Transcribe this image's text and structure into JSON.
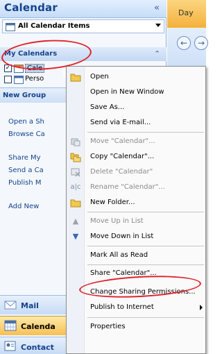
{
  "pane": {
    "title": "Calendar",
    "collapse_glyph": "«",
    "view_select_label": "All Calendar Items",
    "my_calendars_label": "My Calendars",
    "my_calendars_chevron": "⌃",
    "calendars": [
      {
        "label": "Cale",
        "checked": true
      },
      {
        "label": "Perso",
        "checked": false
      }
    ],
    "new_group_label": "New Group",
    "links": {
      "open": "Open a Sh",
      "browse": "Browse Ca",
      "share": "Share My",
      "send": "Send a Ca",
      "publish": "Publish M",
      "add_new": "Add New"
    },
    "nav_buttons": {
      "mail": "Mail",
      "calendar": "Calenda",
      "contacts": "Contact"
    }
  },
  "calendar_area": {
    "tab_day": "Day",
    "prev_glyph": "←",
    "next_glyph": "→"
  },
  "context_menu": {
    "items": [
      {
        "label": "Open",
        "enabled": true,
        "icon": "open-folder-icon"
      },
      {
        "label": "Open in New Window",
        "enabled": true,
        "icon": ""
      },
      {
        "label": "Save As...",
        "enabled": true,
        "icon": ""
      },
      {
        "label": "Send via E-mail...",
        "enabled": true,
        "icon": ""
      },
      {
        "label": "Move \"Calendar\"...",
        "enabled": false,
        "icon": "move-icon"
      },
      {
        "label": "Copy \"Calendar\"...",
        "enabled": true,
        "icon": "copy-icon"
      },
      {
        "label": "Delete \"Calendar\"",
        "enabled": false,
        "icon": "delete-icon"
      },
      {
        "label": "Rename \"Calendar\"...",
        "enabled": false,
        "icon": "rename-icon"
      },
      {
        "label": "New Folder...",
        "enabled": true,
        "icon": "new-folder-icon"
      },
      {
        "label": "Move Up in List",
        "enabled": false,
        "icon": "arrow-up-icon"
      },
      {
        "label": "Move Down in List",
        "enabled": true,
        "icon": "arrow-down-icon"
      },
      {
        "label": "Mark All as Read",
        "enabled": true,
        "icon": ""
      },
      {
        "label": "Share \"Calendar\"...",
        "enabled": true,
        "icon": ""
      },
      {
        "label": "Change Sharing Permissions...",
        "enabled": true,
        "icon": ""
      },
      {
        "label": "Publish to Internet",
        "enabled": true,
        "icon": "",
        "submenu": true
      },
      {
        "label": "Properties",
        "enabled": true,
        "icon": ""
      }
    ]
  },
  "colors": {
    "annotation": "#e0202a",
    "pane_header_text": "#15428b",
    "selected_nav": "#f6c054"
  }
}
